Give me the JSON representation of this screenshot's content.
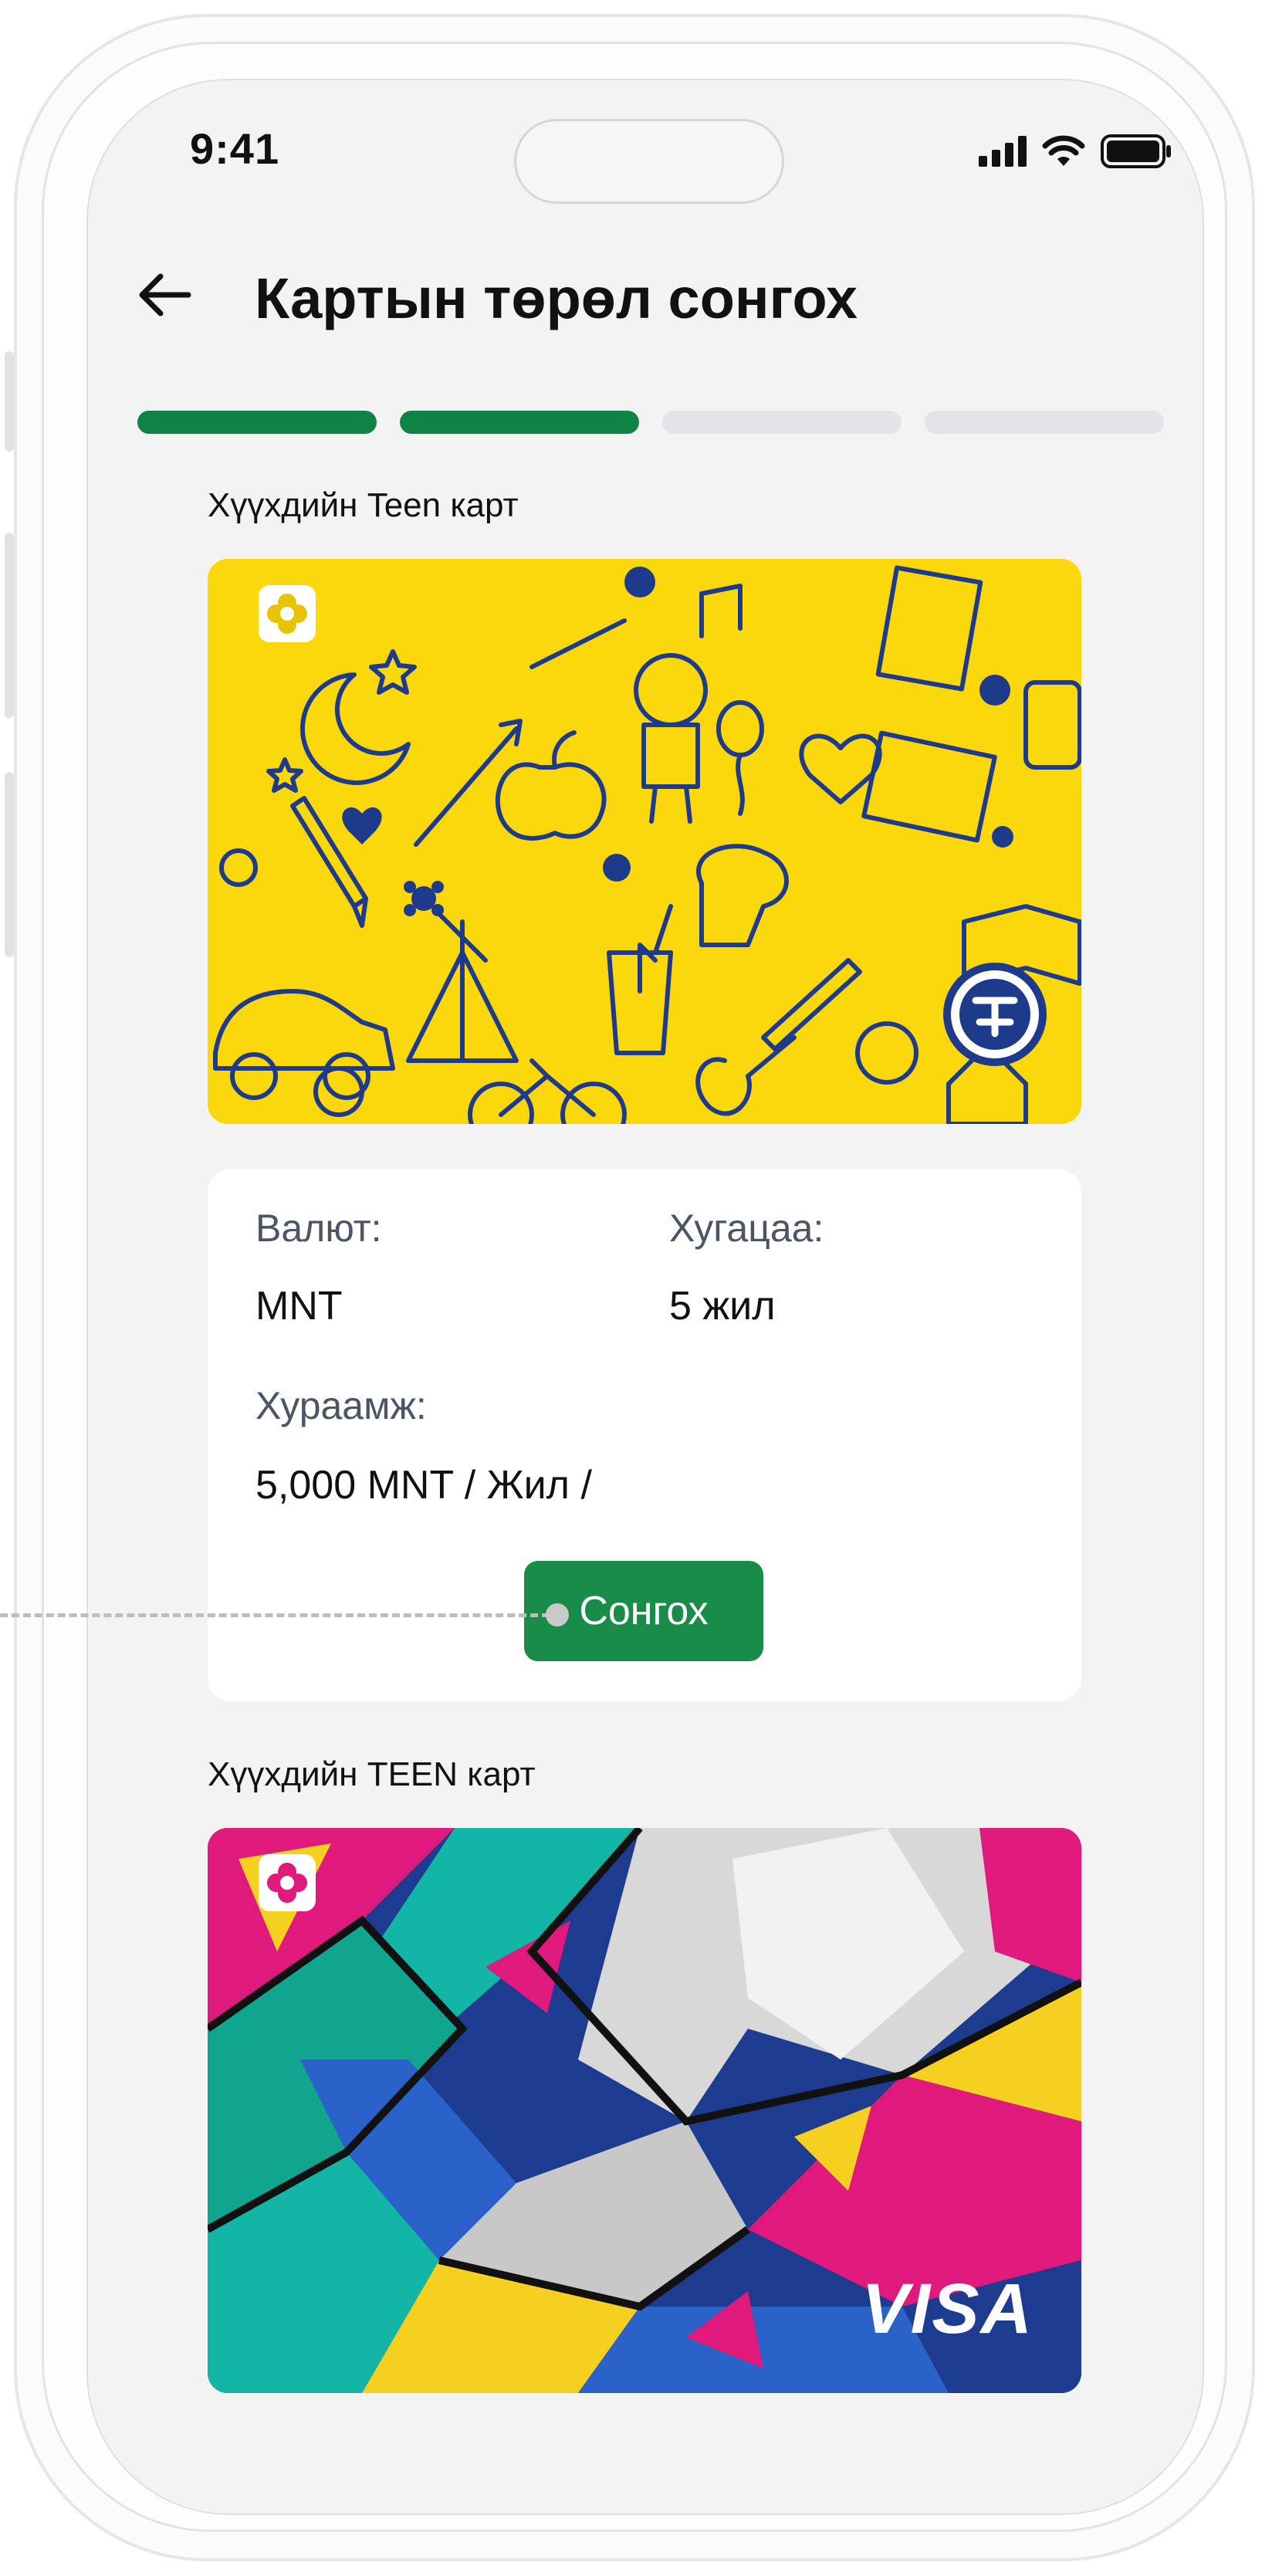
{
  "status_bar": {
    "time": "9:41"
  },
  "header": {
    "title": "Картын төрөл сонгох"
  },
  "progress": {
    "steps_total": 4,
    "steps_done": 2,
    "active_color": "#0f8246",
    "inactive_color": "#e3e4e8"
  },
  "cards": [
    {
      "label": "Хүүхдийн Teen карт",
      "image": "yellow-doodle-card",
      "details": {
        "currency_label": "Валют:",
        "currency_value": "MNT",
        "term_label": "Хугацаа:",
        "term_value": "5 жил",
        "fee_label": "Хураамж:",
        "fee_value": "5,000  MNT / Жил /"
      },
      "select_label": "Сонгох"
    },
    {
      "label": "Хүүхдийн TEEN карт",
      "image": "colorful-abstract-card",
      "brand": "VISA"
    }
  ],
  "colors": {
    "accent": "#1a8c4a",
    "card_yellow": "#fbd80c",
    "doodle_blue": "#1e3a8a"
  }
}
